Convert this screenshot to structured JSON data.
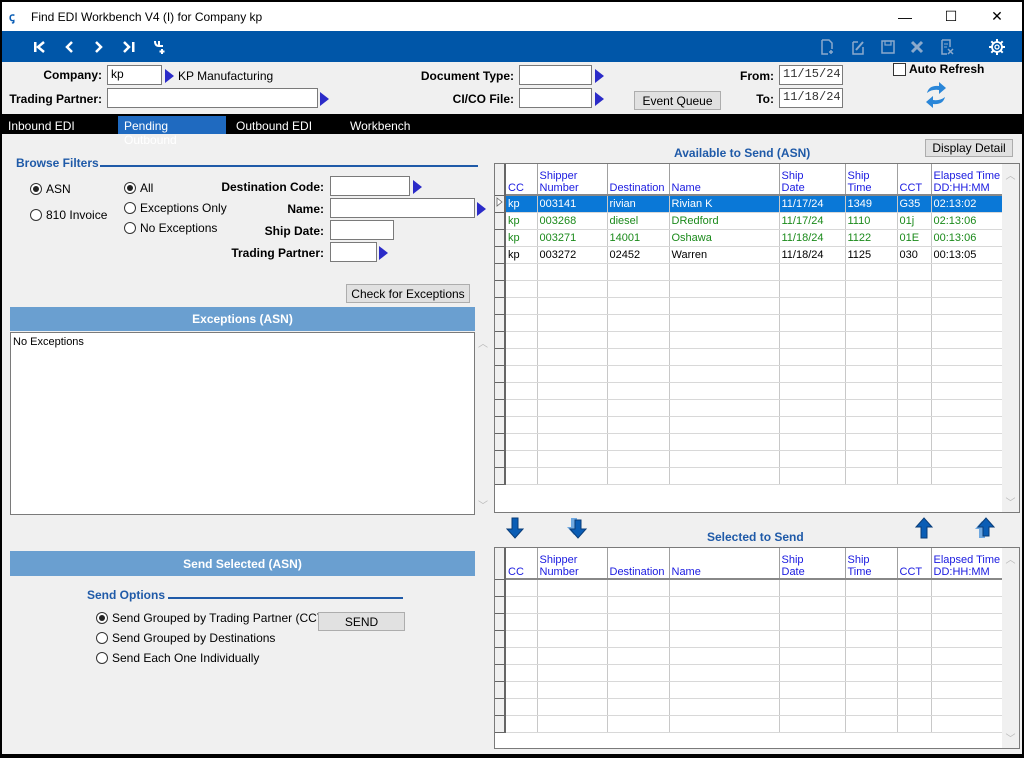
{
  "window": {
    "title": "Find EDI Workbench V4 (I) for Company kp",
    "minimize": "—",
    "maximize": "☐",
    "close": "✕"
  },
  "toolbar": {
    "nav": [
      {
        "icon": "first-record-icon",
        "glyph": "K"
      },
      {
        "icon": "previous-record-icon",
        "glyph": "‹"
      },
      {
        "icon": "next-record-icon",
        "glyph": "›"
      },
      {
        "icon": "last-record-icon",
        "glyph": "›I"
      },
      {
        "icon": "add-link-icon",
        "glyph": "ꞔ"
      }
    ],
    "actions": [
      {
        "icon": "new-document-icon",
        "glyph": "🗋"
      },
      {
        "icon": "edit-document-icon",
        "glyph": "✎"
      },
      {
        "icon": "save-icon",
        "glyph": "💾"
      },
      {
        "icon": "delete-icon",
        "glyph": "✖"
      },
      {
        "icon": "clear-document-icon",
        "glyph": "🗎"
      },
      {
        "icon": "settings-gear-icon",
        "glyph": "⚙"
      }
    ]
  },
  "header": {
    "company_label": "Company:",
    "company_value": "kp",
    "company_name": "KP Manufacturing",
    "trading_partner_label": "Trading Partner:",
    "trading_partner_value": "",
    "document_type_label": "Document Type:",
    "document_type_value": "",
    "cico_file_label": "CI/CO File:",
    "cico_file_value": "",
    "event_queue_button": "Event Queue",
    "from_label": "From:",
    "from_value": "11/15/24",
    "to_label": "To:",
    "to_value": "11/18/24",
    "auto_refresh_label": "Auto Refresh",
    "auto_refresh_checked": false
  },
  "tabs": [
    {
      "label": "Inbound EDI",
      "active": false
    },
    {
      "label": "Pending Outbound",
      "active": true
    },
    {
      "label": "Outbound EDI",
      "active": false
    },
    {
      "label": "Workbench",
      "active": false
    }
  ],
  "filters": {
    "title": "Browse Filters",
    "doc_types": [
      {
        "label": "ASN",
        "checked": true
      },
      {
        "label": "810 Invoice",
        "checked": false
      }
    ],
    "exception_modes": [
      {
        "label": "All",
        "checked": true
      },
      {
        "label": "Exceptions Only",
        "checked": false
      },
      {
        "label": "No Exceptions",
        "checked": false
      }
    ],
    "destination_code_label": "Destination Code:",
    "destination_code_value": "",
    "name_label": "Name:",
    "name_value": "",
    "ship_date_label": "Ship Date:",
    "ship_date_value": "",
    "trading_partner_label": "Trading Partner:",
    "trading_partner_value": "",
    "check_exceptions_button": "Check for Exceptions"
  },
  "exceptions": {
    "title": "Exceptions (ASN)",
    "text": "No Exceptions"
  },
  "send": {
    "title": "Send Selected (ASN)",
    "options_title": "Send Options",
    "options": [
      {
        "label": "Send Grouped by Trading Partner (CCT)",
        "checked": true
      },
      {
        "label": "Send Grouped by Destinations",
        "checked": false
      },
      {
        "label": "Send Each One Individually",
        "checked": false
      }
    ],
    "send_button": "SEND"
  },
  "available": {
    "title": "Available to Send  (ASN)",
    "display_detail_button": "Display Detail",
    "columns": [
      {
        "line1": "",
        "line2": "CC"
      },
      {
        "line1": "Shipper",
        "line2": "Number"
      },
      {
        "line1": "",
        "line2": "Destination"
      },
      {
        "line1": "",
        "line2": "Name"
      },
      {
        "line1": "Ship",
        "line2": "Date"
      },
      {
        "line1": "Ship",
        "line2": "Time"
      },
      {
        "line1": "",
        "line2": "CCT"
      },
      {
        "line1": "Elapsed Time",
        "line2": "DD:HH:MM"
      }
    ],
    "rows": [
      {
        "cells": [
          "kp",
          "003141",
          "rivian",
          "Rivian K",
          "11/17/24",
          "1349",
          "G35",
          "02:13:02"
        ],
        "status": "selected"
      },
      {
        "cells": [
          "kp",
          "003268",
          "diesel",
          "DRedford",
          "11/17/24",
          "1110",
          "01j",
          "02:13:06"
        ],
        "status": "green"
      },
      {
        "cells": [
          "kp",
          "003271",
          "14001",
          "Oshawa",
          "11/18/24",
          "1122",
          "01E",
          "00:13:06"
        ],
        "status": "green"
      },
      {
        "cells": [
          "kp",
          "003272",
          "02452",
          "Warren",
          "11/18/24",
          "1125",
          "030",
          "00:13:05"
        ],
        "status": "normal"
      }
    ]
  },
  "selected": {
    "title": "Selected to Send",
    "columns": [
      {
        "line1": "",
        "line2": "CC"
      },
      {
        "line1": "Shipper",
        "line2": "Number"
      },
      {
        "line1": "",
        "line2": "Destination"
      },
      {
        "line1": "",
        "line2": "Name"
      },
      {
        "line1": "Ship",
        "line2": "Date"
      },
      {
        "line1": "Ship",
        "line2": "Time"
      },
      {
        "line1": "",
        "line2": "CCT"
      },
      {
        "line1": "Elapsed Time",
        "line2": "DD:HH:MM"
      }
    ],
    "rows": []
  },
  "colors": {
    "toolbar": "#0056a8",
    "accent_title": "#1f5aa8",
    "section_bar": "#6a9fd0",
    "selected_row": "#0a78d7",
    "green_row": "#1b8a1b",
    "header_text": "#1a1ae0"
  }
}
